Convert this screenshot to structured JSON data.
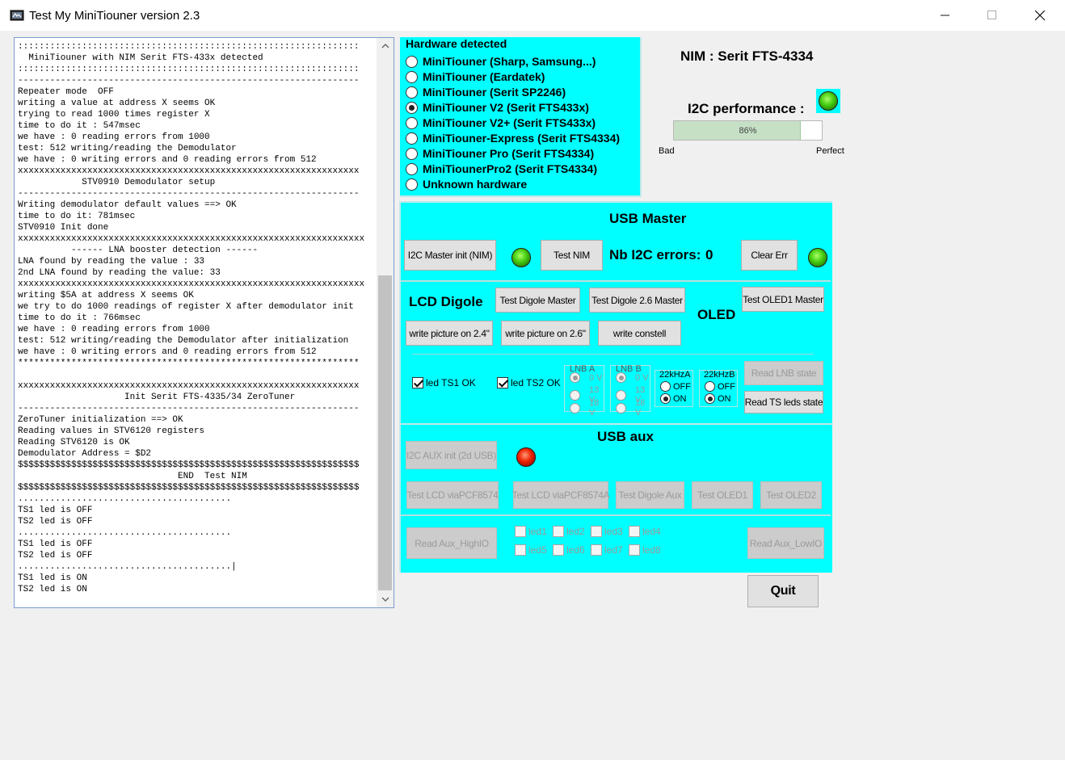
{
  "window": {
    "title": "Test My MiniTiouner version 2.3",
    "app_icon": "app-icon",
    "controls": {
      "minimize": "─",
      "maximize": "☐",
      "close": "✕"
    }
  },
  "log": {
    "lines": [
      "::::::::::::::::::::::::::::::::::::::::::::::::::::::::::::::::",
      "  MiniTiouner with NIM Serit FTS-433x detected",
      "::::::::::::::::::::::::::::::::::::::::::::::::::::::::::::::::",
      "----------------------------------------------------------------",
      "Repeater mode  OFF",
      "writing a value at address X seems OK",
      "trying to read 1000 times register X",
      "time to do it : 547msec",
      "we have : 0 reading errors from 1000",
      "test: 512 writing/reading the Demodulator",
      "we have : 0 writing errors and 0 reading errors from 512",
      "xxxxxxxxxxxxxxxxxxxxxxxxxxxxxxxxxxxxxxxxxxxxxxxxxxxxxxxxxxxxxxxx",
      "            STV0910 Demodulator setup",
      "----------------------------------------------------------------",
      "Writing demodulator default values ==> OK",
      "time to do it: 781msec",
      "STV0910 Init done",
      "xxxxxxxxxxxxxxxxxxxxxxxxxxxxxxxxxxxxxxxxxxxxxxxxxxxxxxxxxxxxxxxxx",
      "          ------ LNA booster detection ------",
      "LNA found by reading the value : 33",
      "2nd LNA found by reading the value: 33",
      "xxxxxxxxxxxxxxxxxxxxxxxxxxxxxxxxxxxxxxxxxxxxxxxxxxxxxxxxxxxxxxxxx",
      "writing $5A at address X seems OK",
      "we try to do 1000 readings of register X after demodulator init",
      "time to do it : 766msec",
      "we have : 0 reading errors from 1000",
      "test: 512 writing/reading the Demodulator after initialization",
      "we have : 0 writing errors and 0 reading errors from 512",
      "****************************************************************",
      "",
      "xxxxxxxxxxxxxxxxxxxxxxxxxxxxxxxxxxxxxxxxxxxxxxxxxxxxxxxxxxxxxxxx",
      "                    Init Serit FTS-4335/34 ZeroTuner",
      "----------------------------------------------------------------",
      "ZeroTuner initialization ==> OK",
      "Reading values in STV6120 registers",
      "Reading STV6120 is OK",
      "Demodulator Address = $D2",
      "$$$$$$$$$$$$$$$$$$$$$$$$$$$$$$$$$$$$$$$$$$$$$$$$$$$$$$$$$$$$$$$$",
      "                              END  Test NIM",
      "$$$$$$$$$$$$$$$$$$$$$$$$$$$$$$$$$$$$$$$$$$$$$$$$$$$$$$$$$$$$$$$$",
      "........................................",
      "TS1 led is OFF",
      "TS2 led is OFF",
      "........................................",
      "TS1 led is OFF",
      "TS2 led is OFF",
      "........................................|",
      "TS1 led is ON",
      "TS2 led is ON"
    ],
    "scroll_up": "⌃",
    "scroll_down": "⌄"
  },
  "hardware": {
    "title": "Hardware detected",
    "options": [
      {
        "label": "MiniTiouner (Sharp, Samsung...)",
        "selected": false
      },
      {
        "label": "MiniTiouner (Eardatek)",
        "selected": false
      },
      {
        "label": "MiniTiouner (Serit SP2246)",
        "selected": false
      },
      {
        "label": "MiniTiouner V2 (Serit FTS433x)",
        "selected": true
      },
      {
        "label": "MiniTiouner V2+ (Serit FTS433x)",
        "selected": false
      },
      {
        "label": "MiniTiouner-Express (Serit FTS4334)",
        "selected": false
      },
      {
        "label": "MiniTiouner Pro  (Serit FTS4334)",
        "selected": false
      },
      {
        "label": "MiniTiounerPro2 (Serit FTS4334)",
        "selected": false
      },
      {
        "label": "Unknown hardware",
        "selected": false
      }
    ]
  },
  "nim": {
    "label": "NIM : Serit FTS-4334"
  },
  "i2c_performance": {
    "label": "I2C performance :",
    "percent": 86,
    "percent_text": "86%",
    "bad_label": "Bad",
    "perfect_label": "Perfect",
    "led": "green"
  },
  "usb_master": {
    "title": "USB Master",
    "i2c_master_init": "I2C Master init (NIM)",
    "test_nim": "Test NIM",
    "nb_i2c_errors_label": "Nb I2C errors:",
    "nb_i2c_errors_value": "0",
    "clear_err": "Clear Err",
    "led_init": "green",
    "led_errors": "green",
    "lcd_digole_label": "LCD Digole",
    "test_digole_master": "Test Digole Master",
    "test_digole_26_master": "Test Digole 2.6 Master",
    "oled_label": "OLED",
    "test_oled1_master": "Test OLED1 Master",
    "write_picture_24": "write picture on 2.4\"",
    "write_picture_26": "write picture on 2.6\"",
    "write_constell": "write constell",
    "led_ts1": {
      "label": "led TS1 OK",
      "checked": true
    },
    "led_ts2": {
      "label": "led TS2 OK",
      "checked": true
    },
    "lnb_a": {
      "title": "LNB A",
      "options": [
        "0 V",
        "13 V",
        "18 V"
      ],
      "selected": 0
    },
    "lnb_b": {
      "title": "LNB B",
      "options": [
        "0 V",
        "13 V",
        "18 V"
      ],
      "selected": 0
    },
    "k22_a": {
      "title": "22kHzA",
      "options": [
        "OFF",
        "ON"
      ],
      "selected": 1
    },
    "k22_b": {
      "title": "22kHzB",
      "options": [
        "OFF",
        "ON"
      ],
      "selected": 1
    },
    "read_lnb_state": "Read LNB state",
    "read_ts_leds_state": "Read TS leds state"
  },
  "usb_aux": {
    "title": "USB aux",
    "i2c_aux_init": "I2C AUX init (2d USB)",
    "led_aux": "red",
    "test_lcd_pcf8574": "Test LCD viaPCF8574",
    "test_lcd_pcf8574a": "Test LCD viaPCF8574A",
    "test_digole_aux": "Test Digole Aux",
    "test_oled1": "Test OLED1",
    "test_oled2": "Test OLED2",
    "read_aux_high": "Read Aux_HighIO",
    "read_aux_low": "Read Aux_LowIO",
    "leds": [
      "led1",
      "led2",
      "led3",
      "led4",
      "led5",
      "led6",
      "led7",
      "led8"
    ]
  },
  "quit": "Quit"
}
